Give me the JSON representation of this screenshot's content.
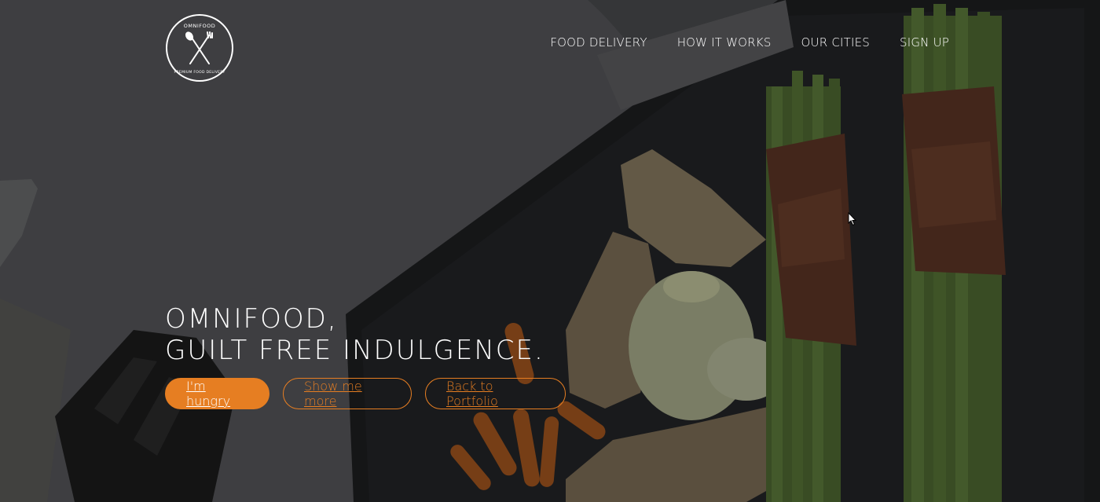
{
  "logo": {
    "alt": "Omnifood logo",
    "top_text": "OMNIFOOD",
    "bottom_text": "PREMIUM FOOD DELIVERY",
    "icon": "fork-spoon-icon"
  },
  "nav": {
    "items": [
      {
        "label": "FOOD DELIVERY"
      },
      {
        "label": "HOW IT WORKS"
      },
      {
        "label": "OUR CITIES"
      },
      {
        "label": "SIGN UP"
      }
    ]
  },
  "hero": {
    "headline_line1": "OMNIFOOD,",
    "headline_line2": "GUILT FREE INDULGENCE.",
    "buttons": {
      "primary": "I'm hungry",
      "secondary": "Show me more",
      "tertiary": "Back to Portfolio"
    }
  },
  "colors": {
    "accent": "#e67e22",
    "text": "#ffffff"
  }
}
